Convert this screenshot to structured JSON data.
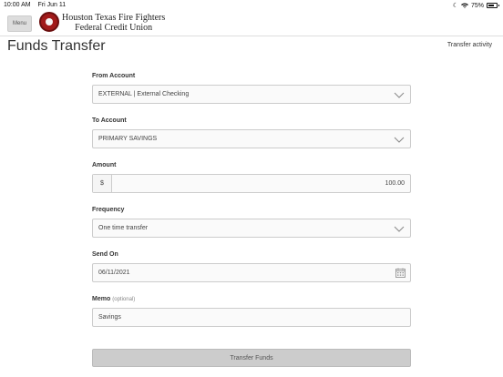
{
  "status": {
    "time": "10:00 AM",
    "date": "Fri Jun 11",
    "battery": "75%"
  },
  "header": {
    "menu_label": "Menu",
    "logo_line1": "Houston Texas Fire Fighters",
    "logo_line2": "Federal Credit Union"
  },
  "page": {
    "title": "Funds Transfer",
    "activity_link": "Transfer activity"
  },
  "form": {
    "from_label": "From Account",
    "from_value": "EXTERNAL | External Checking",
    "to_label": "To Account",
    "to_value": "PRIMARY SAVINGS",
    "amount_label": "Amount",
    "amount_prefix": "$",
    "amount_value": "100.00",
    "frequency_label": "Frequency",
    "frequency_value": "One time transfer",
    "sendon_label": "Send On",
    "sendon_value": "06/11/2021",
    "memo_label": "Memo",
    "memo_optional": "(optional)",
    "memo_value": "Savings"
  },
  "submit_label": "Transfer Funds",
  "colors": {
    "seal": "#a11a1a",
    "button": "#cccccc"
  }
}
